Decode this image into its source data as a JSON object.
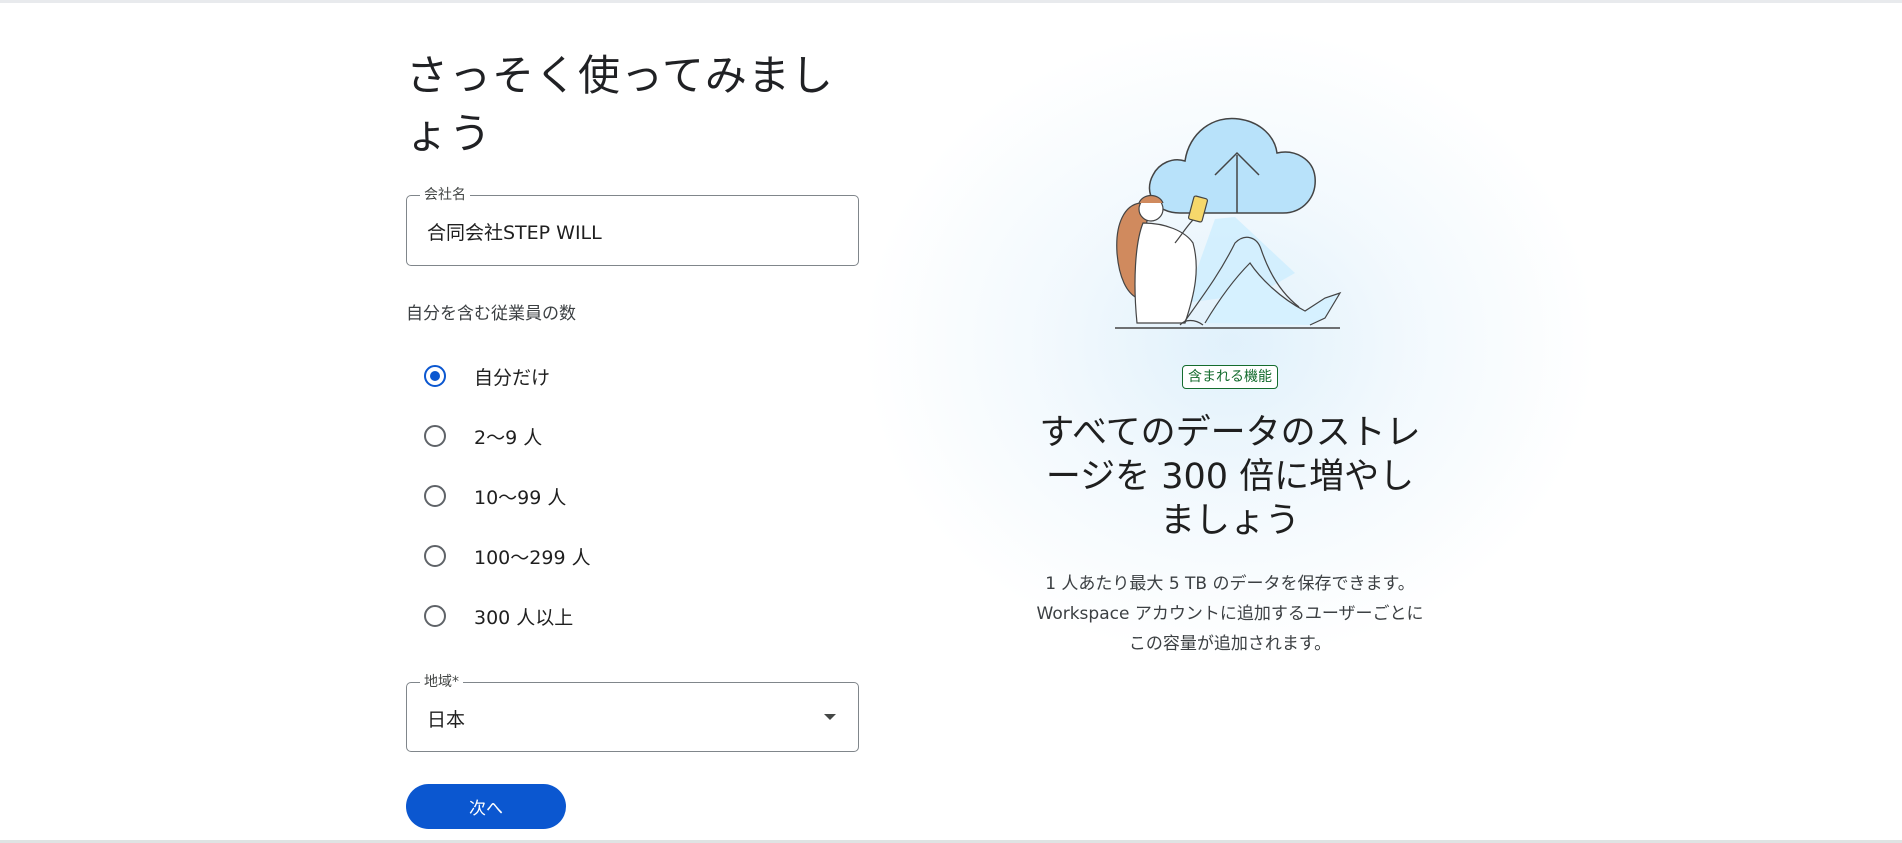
{
  "form": {
    "title": "さっそく使ってみましょう",
    "company": {
      "legend": "会社名",
      "value": "合同会社STEP WILL"
    },
    "employees": {
      "label": "自分を含む従業員の数",
      "options": [
        {
          "label": "自分だけ",
          "selected": true
        },
        {
          "label": "2～9 人",
          "selected": false
        },
        {
          "label": "10～99 人",
          "selected": false
        },
        {
          "label": "100～299 人",
          "selected": false
        },
        {
          "label": "300 人以上",
          "selected": false
        }
      ]
    },
    "region": {
      "legend": "地域*",
      "value": "日本"
    },
    "next_label": "次へ"
  },
  "promo": {
    "badge": "含まれる機能",
    "heading": "すべてのデータのストレージを 300 倍に増やしましょう",
    "description": "1 人あたり最大 5 TB のデータを保存できます。Workspace アカウントに追加するユーザーごとにこの容量が追加されます。"
  },
  "colors": {
    "primary": "#0b57d0",
    "badge_green": "#146c2e",
    "cloud": "#b8e2fa"
  }
}
